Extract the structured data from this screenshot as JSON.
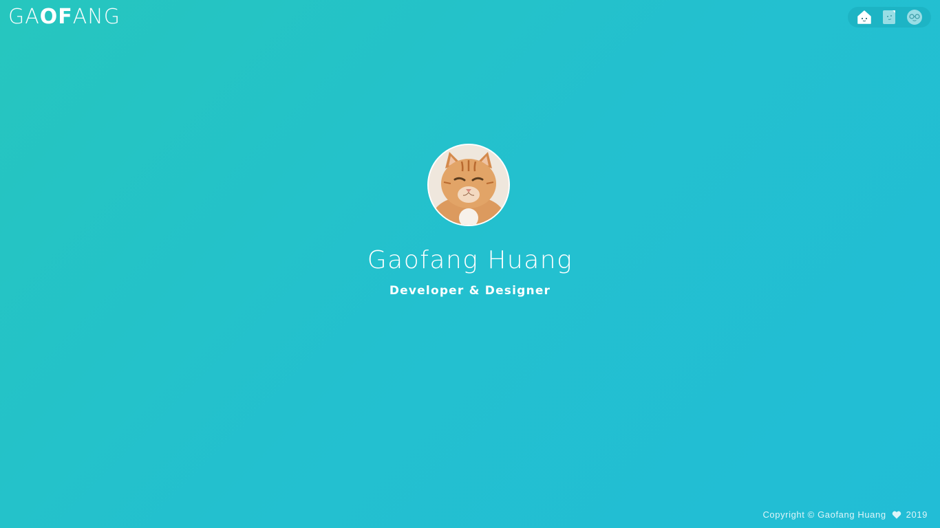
{
  "logo": {
    "part1": "GA",
    "part2": "OF",
    "part3": "ANG"
  },
  "nav": {
    "items": [
      {
        "icon": "home-face-icon"
      },
      {
        "icon": "notebook-icon"
      },
      {
        "icon": "glasses-face-icon"
      }
    ]
  },
  "profile": {
    "name": "Gaofang Huang",
    "role": "Developer & Designer",
    "avatar_icon": "cat-avatar"
  },
  "footer": {
    "copyright": "Copyright © Gaofang Huang",
    "heart_icon": "heart-icon",
    "year": "2019"
  },
  "colors": {
    "background_start": "#26c6be",
    "background_end": "#22bdd6",
    "text": "#ffffff"
  }
}
